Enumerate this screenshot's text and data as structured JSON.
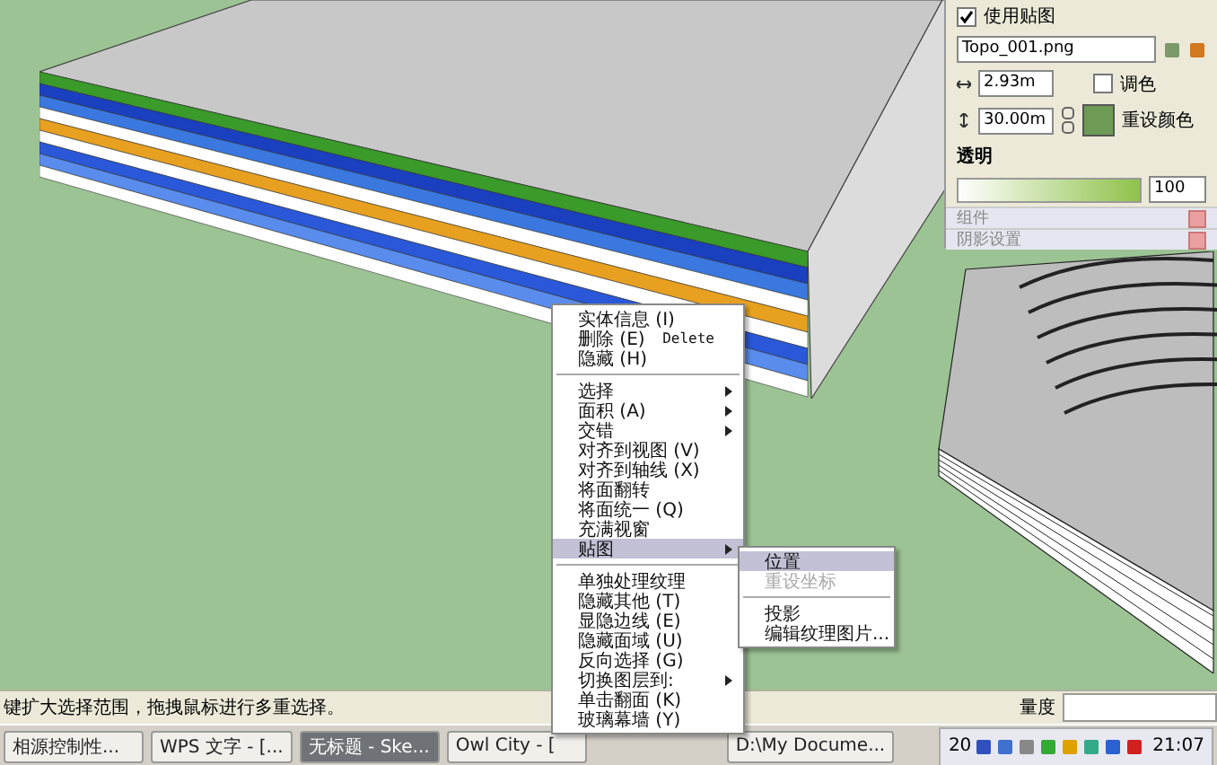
{
  "texture_panel": {
    "use_texture": {
      "label": "使用贴图",
      "checked": true
    },
    "file": "Topo_001.png",
    "width": "2.93m",
    "height": "30.00m",
    "tint": {
      "label": "调色",
      "checked": false
    },
    "reset_color": "重设颜色",
    "opacity": {
      "label": "透明",
      "level": 1,
      "value": "100"
    }
  },
  "collapsed_panels": [
    "组件",
    "阴影设置"
  ],
  "context_menu": {
    "groups": [
      [
        {
          "label": "实体信息 (I)",
          "submenu": false,
          "selected": false
        },
        {
          "label": "删除 (E)",
          "shortcut": "Delete",
          "submenu": false,
          "selected": false
        },
        {
          "label": "隐藏 (H)",
          "submenu": false,
          "selected": false
        }
      ],
      [
        {
          "label": "选择",
          "submenu": true,
          "selected": false
        },
        {
          "label": "面积 (A)",
          "submenu": true,
          "selected": false
        },
        {
          "label": "交错",
          "submenu": true,
          "selected": false
        },
        {
          "label": "对齐到视图 (V)",
          "submenu": false,
          "selected": false
        },
        {
          "label": "对齐到轴线 (X)",
          "submenu": false,
          "selected": false
        },
        {
          "label": "将面翻转",
          "submenu": false,
          "selected": false
        },
        {
          "label": "将面统一 (Q)",
          "submenu": false,
          "selected": false
        },
        {
          "label": "充满视窗",
          "submenu": false,
          "selected": false
        },
        {
          "label": "贴图",
          "submenu": true,
          "selected": true
        }
      ],
      [
        {
          "label": "单独处理纹理",
          "submenu": false,
          "selected": false
        },
        {
          "label": "隐藏其他 (T)",
          "submenu": false,
          "selected": false
        },
        {
          "label": "显隐边线 (E)",
          "submenu": false,
          "selected": false
        },
        {
          "label": "隐藏面域 (U)",
          "submenu": false,
          "selected": false
        },
        {
          "label": "反向选择 (G)",
          "submenu": false,
          "selected": false
        },
        {
          "label": "切换图层到:",
          "submenu": true,
          "selected": false
        },
        {
          "label": "单击翻面 (K)",
          "submenu": false,
          "selected": false
        },
        {
          "label": "玻璃幕墙 (Y)",
          "submenu": false,
          "selected": false
        }
      ]
    ]
  },
  "submenu": {
    "groups": [
      [
        {
          "label": "位置",
          "selected": true,
          "disabled": false
        },
        {
          "label": "重设坐标",
          "selected": false,
          "disabled": true
        }
      ],
      [
        {
          "label": "投影",
          "selected": false,
          "disabled": false
        },
        {
          "label": "编辑纹理图片...",
          "selected": false,
          "disabled": false
        }
      ]
    ]
  },
  "status_bar": {
    "hint": "键扩大选择范围，拖拽鼠标进行多重选择。",
    "measure_label": "量度"
  },
  "taskbar": {
    "buttons": [
      {
        "label": "相源控制性...",
        "selected": false
      },
      {
        "label": "WPS 文字 - [...",
        "selected": false
      },
      {
        "label": "无标题 - Ske...",
        "selected": true
      },
      {
        "label": "Owl City - [",
        "selected": false
      },
      {
        "label": "D:\\My Docume...",
        "selected": false
      }
    ],
    "tray_date": "20",
    "clock": "21:07"
  }
}
